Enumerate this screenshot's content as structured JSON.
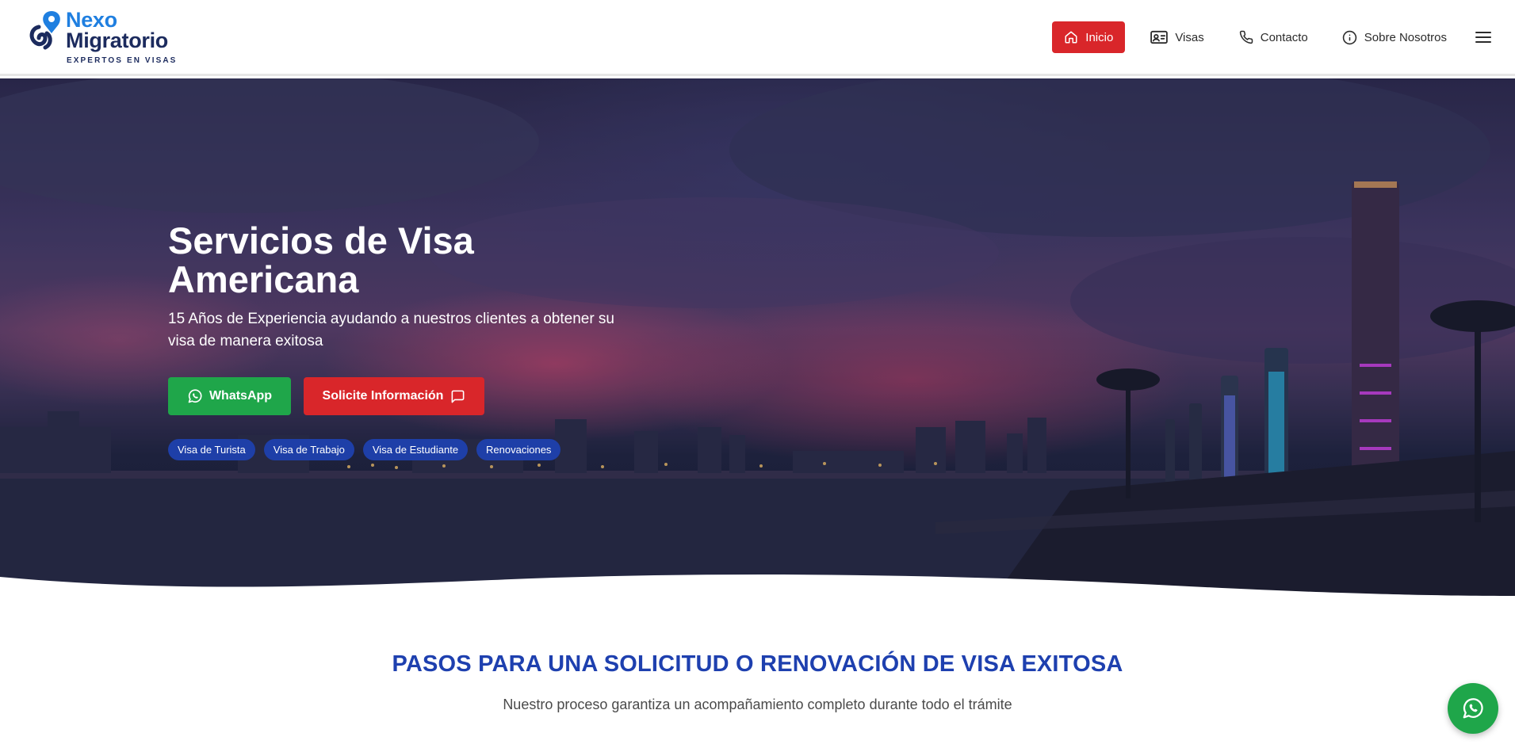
{
  "brand": {
    "name_line1": "Nexo",
    "name_line2": "Migratorio",
    "tagline": "EXPERTOS EN VISAS",
    "color_primary": "#1f7fe0",
    "color_dark": "#1c2b5e"
  },
  "nav": {
    "items": [
      {
        "label": "Inicio",
        "icon": "home-icon",
        "active": true
      },
      {
        "label": "Visas",
        "icon": "id-card-icon",
        "active": false
      },
      {
        "label": "Contacto",
        "icon": "phone-icon",
        "active": false
      },
      {
        "label": "Sobre Nosotros",
        "icon": "info-icon",
        "active": false
      }
    ],
    "menu_icon": "hamburger-menu-icon",
    "active_color": "#d9262a"
  },
  "hero": {
    "title": "Servicios de Visa Americana",
    "subtitle": "15 Años de Experiencia ayudando a nuestros clientes a obtener su visa de manera exitosa",
    "buttons": {
      "whatsapp": {
        "label": "WhatsApp",
        "icon": "whatsapp-icon",
        "color": "#1fa64a"
      },
      "info": {
        "label": "Solicite Información",
        "icon": "chat-bubble-icon",
        "color": "#d9262a"
      }
    },
    "tags": [
      "Visa de Turista",
      "Visa de Trabajo",
      "Visa de Estudiante",
      "Renovaciones"
    ],
    "tag_color": "#1e3fa8"
  },
  "steps": {
    "title": "PASOS PARA UNA SOLICITUD O RENOVACIÓN DE VISA EXITOSA",
    "subtitle": "Nuestro proceso garantiza un acompañamiento completo durante todo el trámite",
    "title_color": "#1e40af"
  },
  "floating_button": {
    "icon": "whatsapp-icon",
    "color": "#1fa64a"
  }
}
